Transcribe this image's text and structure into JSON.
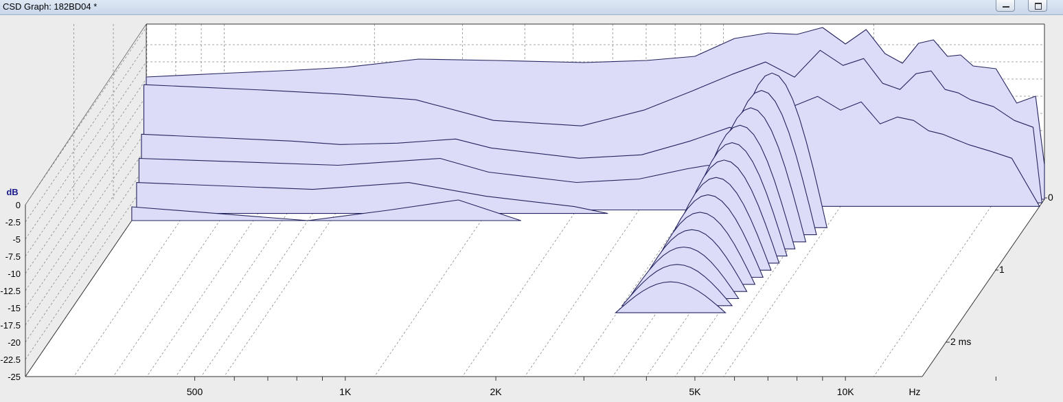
{
  "window": {
    "title": "CSD Graph: 182BD04 *",
    "buttons": [
      "minimize-icon",
      "restore-icon"
    ]
  },
  "colors": {
    "fill": "#dcdcf8",
    "stroke": "#23235f",
    "grid": "#888888",
    "axis_label": "#1a1a8c"
  },
  "chart_data": {
    "type": "area",
    "title": "",
    "xlabel": "Hz",
    "ylabel": "dB",
    "zlabel": "ms",
    "x_scale": "log",
    "x_range": [
      400,
      25000
    ],
    "y_range": [
      -25,
      0
    ],
    "y_ticks": [
      "0",
      "-2.5",
      "-5",
      "-7.5",
      "-10",
      "-12.5",
      "-15",
      "-17.5",
      "-20",
      "-22.5",
      "-25"
    ],
    "x_tick_labels": [
      "500",
      "1K",
      "2K",
      "5K",
      "10K",
      "Hz"
    ],
    "z_tick_labels": [
      "0",
      "1",
      "2 ms"
    ],
    "grid": true,
    "slices": [
      {
        "t": 0.0,
        "points": [
          [
            400,
            -7.2
          ],
          [
            600,
            -6.6
          ],
          [
            800,
            -6.2
          ],
          [
            1000,
            -5.8
          ],
          [
            1400,
            -4.6
          ],
          [
            2000,
            -4.8
          ],
          [
            3000,
            -5.1
          ],
          [
            4000,
            -4.8
          ],
          [
            5000,
            -4.2
          ],
          [
            6000,
            -1.6
          ],
          [
            7000,
            -0.8
          ],
          [
            8000,
            -1.0
          ],
          [
            9000,
            0.0
          ],
          [
            10000,
            -2.4
          ],
          [
            11000,
            -0.3
          ],
          [
            12000,
            -3.8
          ],
          [
            13000,
            -5.2
          ],
          [
            14000,
            -2.3
          ],
          [
            15000,
            -1.8
          ],
          [
            16000,
            -4.2
          ],
          [
            17000,
            -4.0
          ],
          [
            18000,
            -5.6
          ],
          [
            20000,
            -6.0
          ],
          [
            22000,
            -11.0
          ],
          [
            24000,
            -10.0
          ],
          [
            25000,
            -20.0
          ]
        ]
      },
      {
        "t": 0.05,
        "points": [
          [
            400,
            -7.8
          ],
          [
            700,
            -8.6
          ],
          [
            1000,
            -9.2
          ],
          [
            1400,
            -10.0
          ],
          [
            2000,
            -13.0
          ],
          [
            3000,
            -13.8
          ],
          [
            4000,
            -11.5
          ],
          [
            5000,
            -8.7
          ],
          [
            6000,
            -6.3
          ],
          [
            7000,
            -4.5
          ],
          [
            8000,
            -6.7
          ],
          [
            9000,
            -2.8
          ],
          [
            10000,
            -5.0
          ],
          [
            11000,
            -4.0
          ],
          [
            12000,
            -7.6
          ],
          [
            13000,
            -8.5
          ],
          [
            14000,
            -6.2
          ],
          [
            15000,
            -5.8
          ],
          [
            16000,
            -8.5
          ],
          [
            17000,
            -9.0
          ],
          [
            18000,
            -10.0
          ],
          [
            20000,
            -11.0
          ],
          [
            22000,
            -13.0
          ],
          [
            24000,
            -14.0
          ],
          [
            25000,
            -25.0
          ]
        ]
      },
      {
        "t": 0.1,
        "points": [
          [
            400,
            -14.5
          ],
          [
            800,
            -15.5
          ],
          [
            1000,
            -16.0
          ],
          [
            1300,
            -15.8
          ],
          [
            1700,
            -15.2
          ],
          [
            2000,
            -16.5
          ],
          [
            3000,
            -18.0
          ],
          [
            4000,
            -17.5
          ],
          [
            5000,
            -15.5
          ],
          [
            6000,
            -13.5
          ],
          [
            7000,
            -15.0
          ],
          [
            8000,
            -10.5
          ],
          [
            9000,
            -9.0
          ],
          [
            10000,
            -11.0
          ],
          [
            11000,
            -9.8
          ],
          [
            12000,
            -13.0
          ],
          [
            13000,
            -12.0
          ],
          [
            14000,
            -12.5
          ],
          [
            15000,
            -14.0
          ],
          [
            16000,
            -14.5
          ],
          [
            18000,
            -16.0
          ],
          [
            20000,
            -17.0
          ],
          [
            22000,
            -18.0
          ],
          [
            25000,
            -25.0
          ]
        ]
      },
      {
        "t": 0.15,
        "points": [
          [
            400,
            -17.5
          ],
          [
            1000,
            -18.5
          ],
          [
            1600,
            -17.5
          ],
          [
            2000,
            -19.5
          ],
          [
            3000,
            -21.0
          ],
          [
            4000,
            -20.5
          ],
          [
            5000,
            -19.0
          ],
          [
            5500,
            -18.5
          ],
          [
            6000,
            -20.0
          ],
          [
            7000,
            -25.0
          ]
        ]
      },
      {
        "t": 0.2,
        "points": [
          [
            400,
            -20.5
          ],
          [
            900,
            -21.5
          ],
          [
            1400,
            -20.5
          ],
          [
            2000,
            -22.5
          ],
          [
            3000,
            -24.0
          ],
          [
            3500,
            -25.0
          ]
        ]
      },
      {
        "t": 0.3,
        "points": [
          [
            400,
            -23.0
          ],
          [
            900,
            -25.0
          ],
          [
            1300,
            -23.5
          ],
          [
            1800,
            -22.0
          ],
          [
            2400,
            -25.0
          ]
        ]
      }
    ],
    "ridge_slices": [
      {
        "t": 0.4,
        "f": 7800,
        "peak": -2.5
      },
      {
        "t": 0.5,
        "f": 7600,
        "peak": -4.0
      },
      {
        "t": 0.6,
        "f": 7400,
        "peak": -5.5
      },
      {
        "t": 0.7,
        "f": 7200,
        "peak": -7.0
      },
      {
        "t": 0.8,
        "f": 7100,
        "peak": -8.5
      },
      {
        "t": 0.9,
        "f": 7000,
        "peak": -10.0
      },
      {
        "t": 1.0,
        "f": 6900,
        "peak": -11.5
      },
      {
        "t": 1.1,
        "f": 6800,
        "peak": -13.0
      },
      {
        "t": 1.2,
        "f": 6700,
        "peak": -14.5
      },
      {
        "t": 1.3,
        "f": 6600,
        "peak": -16.0
      },
      {
        "t": 1.4,
        "f": 6500,
        "peak": -17.5
      },
      {
        "t": 1.5,
        "f": 6450,
        "peak": -19.0
      },
      {
        "t": 1.6,
        "f": 6400,
        "peak": -20.5
      }
    ]
  }
}
